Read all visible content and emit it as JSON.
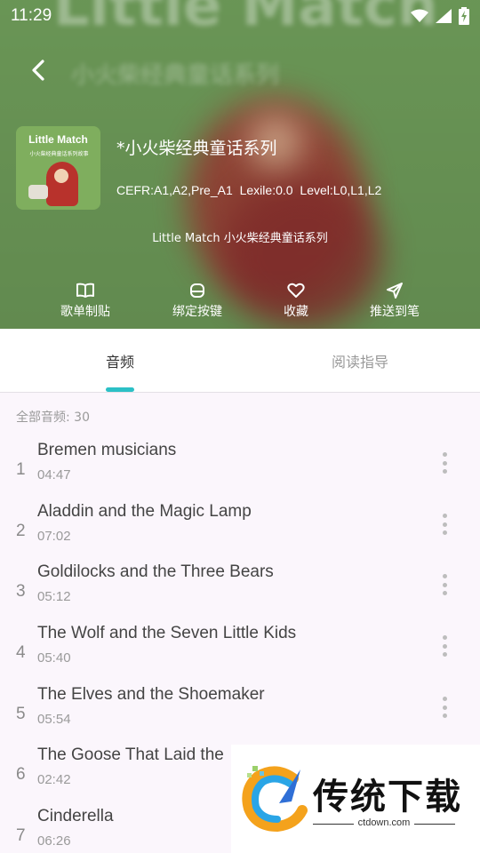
{
  "status_bar": {
    "time": "11:29",
    "icons": [
      "wifi-icon",
      "signal-icon",
      "battery-charging-icon"
    ]
  },
  "header": {
    "background_color": "#6f9d5a",
    "ghost_title": "Little Match",
    "ghost_subtitle": "小火柴经典童话系列",
    "back_icon": "back-arrow-icon",
    "cover": {
      "title": "Little Match",
      "subtitle": "小火柴经典童话系列故事"
    },
    "album_title": "*小火柴经典童话系列",
    "album_meta": "CEFR:A1,A2,Pre_A1 Lexile:0.0 Level:L0,L1,L2",
    "album_description": "Little Match 小火柴经典童话系列",
    "actions": [
      {
        "label": "歌单制贴",
        "icon": "book-icon"
      },
      {
        "label": "绑定按键",
        "icon": "bind-key-icon"
      },
      {
        "label": "收藏",
        "icon": "heart-icon"
      },
      {
        "label": "推送到笔",
        "icon": "send-icon"
      }
    ]
  },
  "tabs": {
    "active_color": "#2bc0c6",
    "items": [
      {
        "label": "音频",
        "active": true
      },
      {
        "label": "阅读指导",
        "active": false
      }
    ]
  },
  "list": {
    "count_label": "全部音频: 30",
    "items": [
      {
        "index": "1",
        "title": "Bremen musicians",
        "duration": "04:47"
      },
      {
        "index": "2",
        "title": "Aladdin and the Magic Lamp",
        "duration": "07:02"
      },
      {
        "index": "3",
        "title": "Goldilocks and the Three Bears",
        "duration": "05:12"
      },
      {
        "index": "4",
        "title": "The Wolf and the Seven Little Kids",
        "duration": "05:40"
      },
      {
        "index": "5",
        "title": "The Elves and the Shoemaker",
        "duration": "05:54"
      },
      {
        "index": "6",
        "title": "The Goose That Laid the",
        "duration": "02:42"
      },
      {
        "index": "7",
        "title": "Cinderella",
        "duration": "06:26"
      }
    ]
  },
  "watermark": {
    "text": "传统下载",
    "url": "ctdown.com"
  }
}
